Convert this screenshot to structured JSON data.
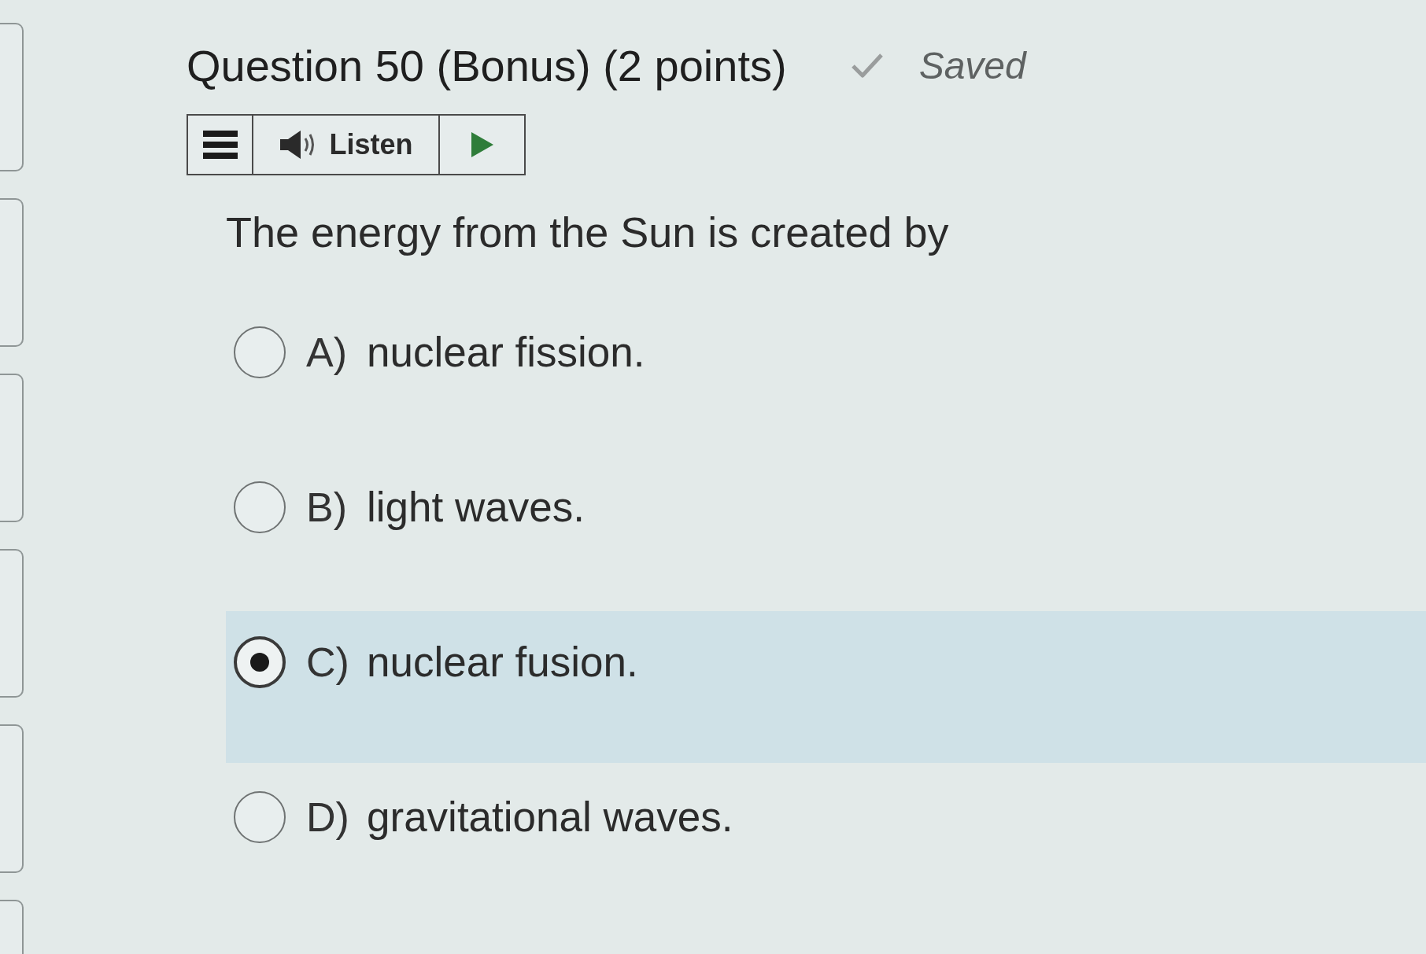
{
  "question": {
    "title": "Question 50 (Bonus) (2 points)",
    "save_status": {
      "saved": true,
      "label": "Saved"
    }
  },
  "toolbar": {
    "listen_label": "Listen"
  },
  "prompt": "The energy from the Sun is created by",
  "options": [
    {
      "letter": "A)",
      "text": "nuclear fission.",
      "selected": false
    },
    {
      "letter": "B)",
      "text": "light waves.",
      "selected": false
    },
    {
      "letter": "C)",
      "text": "nuclear fusion.",
      "selected": true
    },
    {
      "letter": "D)",
      "text": "gravitational waves.",
      "selected": false
    }
  ]
}
